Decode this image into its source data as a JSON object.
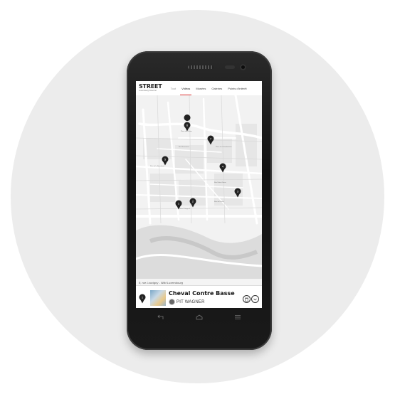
{
  "app": {
    "logo": "STREET",
    "logo_tagline": "Luxembourg Street Art"
  },
  "tabs": [
    {
      "label": "Tout"
    },
    {
      "label": "Vidéos"
    },
    {
      "label": "Musées"
    },
    {
      "label": "Galeries"
    },
    {
      "label": "Points d'intérêt"
    }
  ],
  "map": {
    "pins": [
      {
        "label": "1"
      },
      {
        "label": "2"
      },
      {
        "label": "3"
      },
      {
        "label": "4"
      },
      {
        "label": "5"
      },
      {
        "label": "6"
      },
      {
        "label": "7"
      }
    ],
    "street_labels": [
      "Place des Bains",
      "Rue Beaumont",
      "Place de Clairefontaine",
      "Rue Notre-Dame",
      "Rue Philippe II",
      "Rue du Fossé",
      "Rue de la Boucherie"
    ]
  },
  "detail": {
    "address": "8, rue Louvigny - Wild Luxembourg",
    "pin_number": "1",
    "title": "Cheval Contre Basse",
    "artist": "PIT WAGNER"
  },
  "colors": {
    "accent": "#d33333",
    "pin": "#222222",
    "background": "#ececec"
  },
  "icons": [
    "back-icon",
    "home-icon",
    "menu-icon",
    "trash-icon",
    "chevron-down-icon"
  ]
}
